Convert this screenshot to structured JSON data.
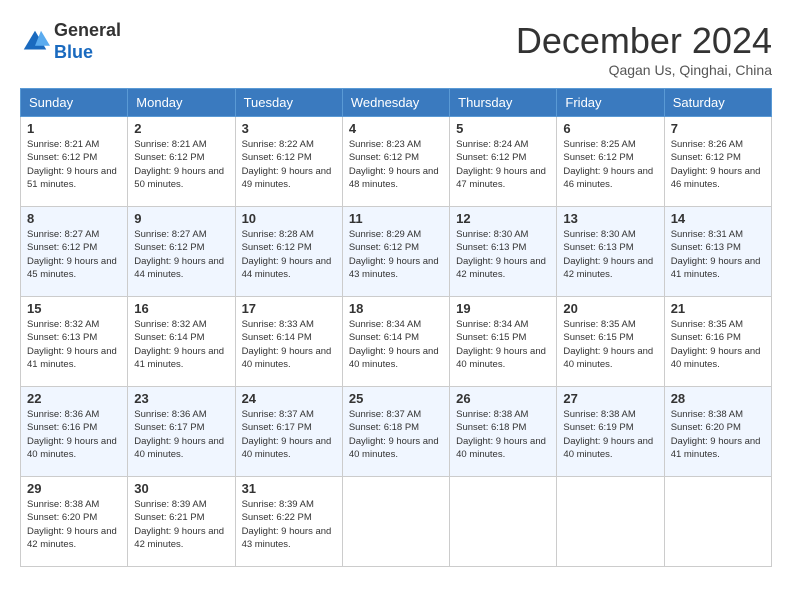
{
  "header": {
    "logo_line1": "General",
    "logo_line2": "Blue",
    "month": "December 2024",
    "location": "Qagan Us, Qinghai, China"
  },
  "weekdays": [
    "Sunday",
    "Monday",
    "Tuesday",
    "Wednesday",
    "Thursday",
    "Friday",
    "Saturday"
  ],
  "weeks": [
    [
      {
        "day": "1",
        "sunrise": "8:21 AM",
        "sunset": "6:12 PM",
        "daylight": "9 hours and 51 minutes."
      },
      {
        "day": "2",
        "sunrise": "8:21 AM",
        "sunset": "6:12 PM",
        "daylight": "9 hours and 50 minutes."
      },
      {
        "day": "3",
        "sunrise": "8:22 AM",
        "sunset": "6:12 PM",
        "daylight": "9 hours and 49 minutes."
      },
      {
        "day": "4",
        "sunrise": "8:23 AM",
        "sunset": "6:12 PM",
        "daylight": "9 hours and 48 minutes."
      },
      {
        "day": "5",
        "sunrise": "8:24 AM",
        "sunset": "6:12 PM",
        "daylight": "9 hours and 47 minutes."
      },
      {
        "day": "6",
        "sunrise": "8:25 AM",
        "sunset": "6:12 PM",
        "daylight": "9 hours and 46 minutes."
      },
      {
        "day": "7",
        "sunrise": "8:26 AM",
        "sunset": "6:12 PM",
        "daylight": "9 hours and 46 minutes."
      }
    ],
    [
      {
        "day": "8",
        "sunrise": "8:27 AM",
        "sunset": "6:12 PM",
        "daylight": "9 hours and 45 minutes."
      },
      {
        "day": "9",
        "sunrise": "8:27 AM",
        "sunset": "6:12 PM",
        "daylight": "9 hours and 44 minutes."
      },
      {
        "day": "10",
        "sunrise": "8:28 AM",
        "sunset": "6:12 PM",
        "daylight": "9 hours and 44 minutes."
      },
      {
        "day": "11",
        "sunrise": "8:29 AM",
        "sunset": "6:12 PM",
        "daylight": "9 hours and 43 minutes."
      },
      {
        "day": "12",
        "sunrise": "8:30 AM",
        "sunset": "6:13 PM",
        "daylight": "9 hours and 42 minutes."
      },
      {
        "day": "13",
        "sunrise": "8:30 AM",
        "sunset": "6:13 PM",
        "daylight": "9 hours and 42 minutes."
      },
      {
        "day": "14",
        "sunrise": "8:31 AM",
        "sunset": "6:13 PM",
        "daylight": "9 hours and 41 minutes."
      }
    ],
    [
      {
        "day": "15",
        "sunrise": "8:32 AM",
        "sunset": "6:13 PM",
        "daylight": "9 hours and 41 minutes."
      },
      {
        "day": "16",
        "sunrise": "8:32 AM",
        "sunset": "6:14 PM",
        "daylight": "9 hours and 41 minutes."
      },
      {
        "day": "17",
        "sunrise": "8:33 AM",
        "sunset": "6:14 PM",
        "daylight": "9 hours and 40 minutes."
      },
      {
        "day": "18",
        "sunrise": "8:34 AM",
        "sunset": "6:14 PM",
        "daylight": "9 hours and 40 minutes."
      },
      {
        "day": "19",
        "sunrise": "8:34 AM",
        "sunset": "6:15 PM",
        "daylight": "9 hours and 40 minutes."
      },
      {
        "day": "20",
        "sunrise": "8:35 AM",
        "sunset": "6:15 PM",
        "daylight": "9 hours and 40 minutes."
      },
      {
        "day": "21",
        "sunrise": "8:35 AM",
        "sunset": "6:16 PM",
        "daylight": "9 hours and 40 minutes."
      }
    ],
    [
      {
        "day": "22",
        "sunrise": "8:36 AM",
        "sunset": "6:16 PM",
        "daylight": "9 hours and 40 minutes."
      },
      {
        "day": "23",
        "sunrise": "8:36 AM",
        "sunset": "6:17 PM",
        "daylight": "9 hours and 40 minutes."
      },
      {
        "day": "24",
        "sunrise": "8:37 AM",
        "sunset": "6:17 PM",
        "daylight": "9 hours and 40 minutes."
      },
      {
        "day": "25",
        "sunrise": "8:37 AM",
        "sunset": "6:18 PM",
        "daylight": "9 hours and 40 minutes."
      },
      {
        "day": "26",
        "sunrise": "8:38 AM",
        "sunset": "6:18 PM",
        "daylight": "9 hours and 40 minutes."
      },
      {
        "day": "27",
        "sunrise": "8:38 AM",
        "sunset": "6:19 PM",
        "daylight": "9 hours and 40 minutes."
      },
      {
        "day": "28",
        "sunrise": "8:38 AM",
        "sunset": "6:20 PM",
        "daylight": "9 hours and 41 minutes."
      }
    ],
    [
      {
        "day": "29",
        "sunrise": "8:38 AM",
        "sunset": "6:20 PM",
        "daylight": "9 hours and 42 minutes."
      },
      {
        "day": "30",
        "sunrise": "8:39 AM",
        "sunset": "6:21 PM",
        "daylight": "9 hours and 42 minutes."
      },
      {
        "day": "31",
        "sunrise": "8:39 AM",
        "sunset": "6:22 PM",
        "daylight": "9 hours and 43 minutes."
      },
      null,
      null,
      null,
      null
    ]
  ],
  "labels": {
    "sunrise": "Sunrise: ",
    "sunset": "Sunset: ",
    "daylight": "Daylight: "
  }
}
